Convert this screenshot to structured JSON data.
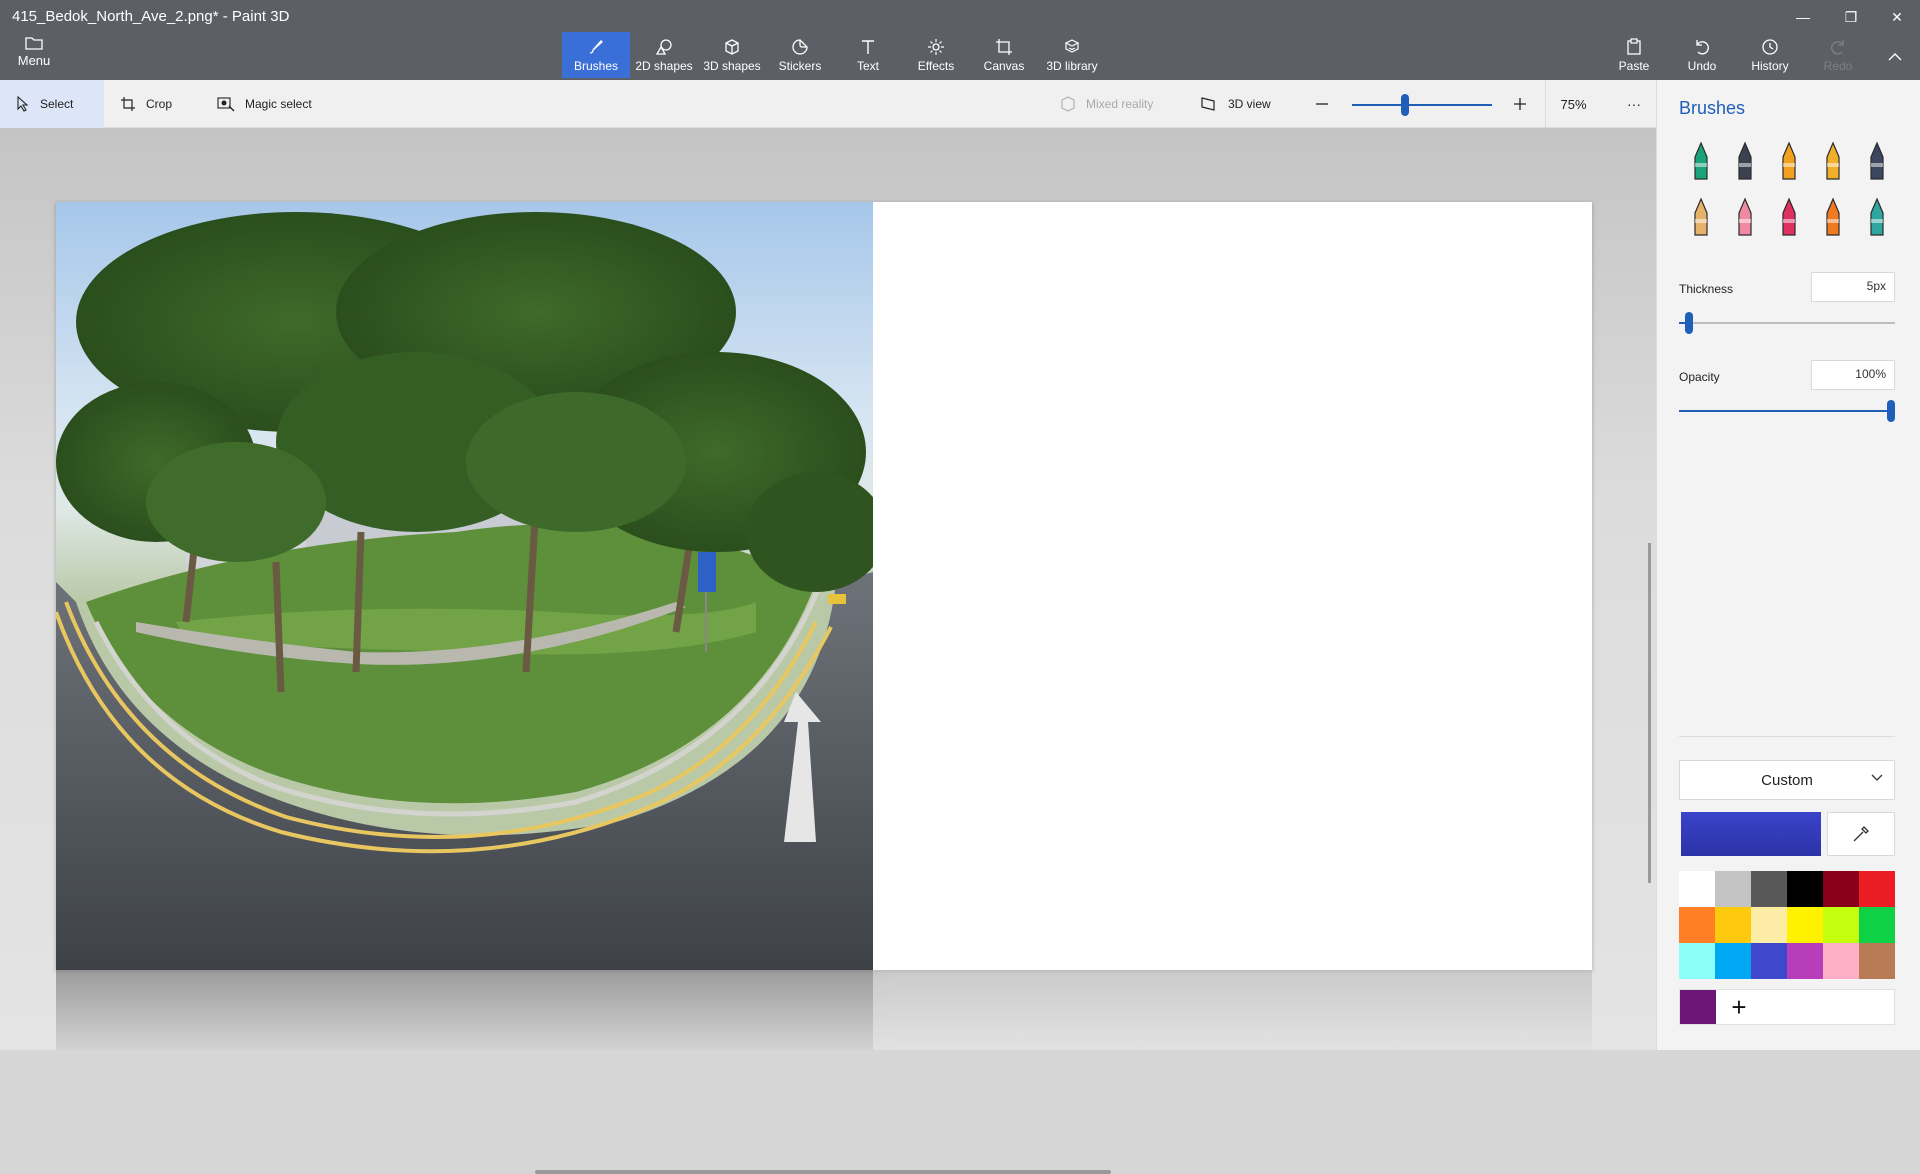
{
  "window": {
    "title": "415_Bedok_North_Ave_2.png* - Paint 3D"
  },
  "menu": {
    "label": "Menu",
    "icon": "folder-icon"
  },
  "tools": [
    {
      "label": "Brushes",
      "icon": "brush-icon",
      "active": true
    },
    {
      "label": "2D shapes",
      "icon": "2d-shapes-icon"
    },
    {
      "label": "3D shapes",
      "icon": "3d-shapes-icon"
    },
    {
      "label": "Stickers",
      "icon": "sticker-icon"
    },
    {
      "label": "Text",
      "icon": "text-icon"
    },
    {
      "label": "Effects",
      "icon": "effects-icon"
    },
    {
      "label": "Canvas",
      "icon": "canvas-icon"
    },
    {
      "label": "3D library",
      "icon": "3d-library-icon"
    }
  ],
  "actions": {
    "paste": "Paste",
    "undo": "Undo",
    "history": "History",
    "redo": "Redo"
  },
  "toolbar": {
    "select": "Select",
    "crop": "Crop",
    "magic_select": "Magic select",
    "mixed_reality": "Mixed reality",
    "view_3d": "3D view",
    "zoom": "75%",
    "zoom_level": 0.37,
    "more": "···"
  },
  "panel": {
    "title": "Brushes",
    "thickness_label": "Thickness",
    "thickness_value": "5px",
    "thickness_level": 0.03,
    "opacity_label": "Opacity",
    "opacity_value": "100%",
    "opacity_level": 1.0,
    "color_mode": "Custom",
    "current_color": "#3a43c9",
    "custom_color": "#6c1677",
    "add_color": "+"
  },
  "brushes": [
    {
      "name": "marker-brush",
      "color": "#1aa37a"
    },
    {
      "name": "calligraphy-pen-brush",
      "color": "#3a4250"
    },
    {
      "name": "oil-brush",
      "color": "#f2a020"
    },
    {
      "name": "watercolor-brush",
      "color": "#f2b02a"
    },
    {
      "name": "pixel-pen-brush",
      "color": "#3c4660"
    },
    {
      "name": "pencil-brush",
      "color": "#e6b16a"
    },
    {
      "name": "eraser-brush",
      "color": "#f08aa0"
    },
    {
      "name": "crayon-brush",
      "color": "#e03060"
    },
    {
      "name": "spray-can-brush",
      "color": "#f07a20"
    },
    {
      "name": "fill-brush",
      "color": "#2fa7a0"
    }
  ],
  "palette": [
    "#ffffff",
    "#c3c3c3",
    "#585858",
    "#000000",
    "#88001b",
    "#ec1c24",
    "#ff7f27",
    "#ffc90e",
    "#fdeca6",
    "#fff200",
    "#c4ff0e",
    "#0ed145",
    "#8cfffb",
    "#00a8f3",
    "#3f48cc",
    "#b83dba",
    "#ffaec8",
    "#b97a56"
  ]
}
